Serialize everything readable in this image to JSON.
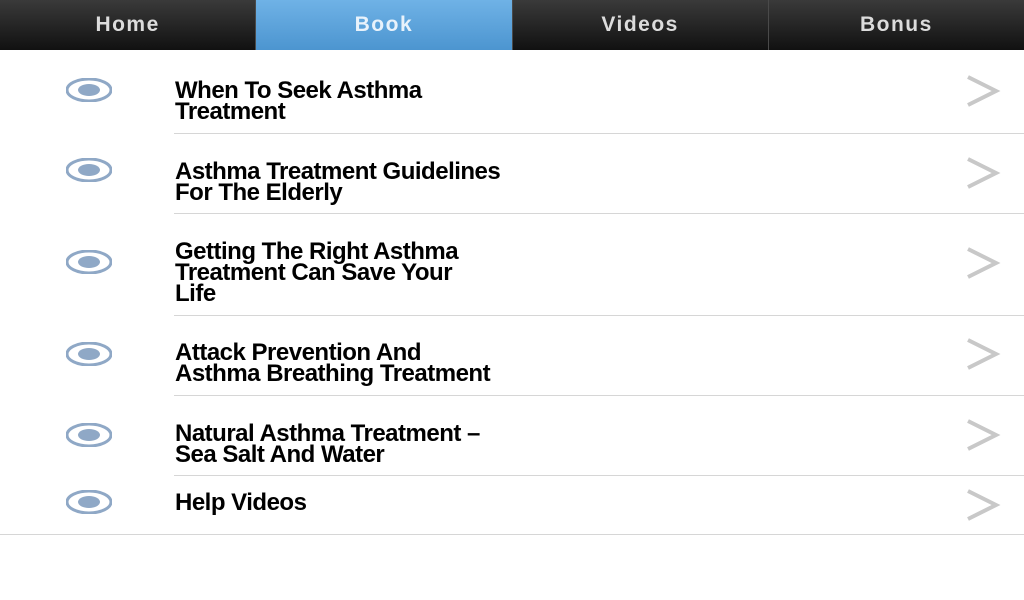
{
  "tabs": [
    {
      "label": "Home",
      "active": false
    },
    {
      "label": "Book",
      "active": true
    },
    {
      "label": "Videos",
      "active": false
    },
    {
      "label": "Bonus",
      "active": false
    }
  ],
  "list_icon": "radio-circle-icon",
  "chevron_icon": "chevron-right-icon",
  "items": [
    {
      "label": "When To Seek Asthma Treatment",
      "line1": "When To Seek Asthma",
      "line2": "Treatment",
      "line3": ""
    },
    {
      "label": "Asthma Treatment Guidelines For The Elderly",
      "line1": "Asthma Treatment Guidelines",
      "line2": "For The Elderly",
      "line3": ""
    },
    {
      "label": "Getting The Right Asthma Treatment Can Save Your Life",
      "line1": "Getting The Right Asthma",
      "line2": "Treatment Can Save Your",
      "line3": "Life"
    },
    {
      "label": "Attack Prevention And Asthma Breathing Treatment",
      "line1": "Attack Prevention And",
      "line2": "Asthma Breathing Treatment",
      "line3": ""
    },
    {
      "label": "Natural Asthma Treatment – Sea Salt And Water",
      "line1": "Natural Asthma Treatment –",
      "line2": "Sea Salt And Water",
      "line3": ""
    },
    {
      "label": "Help Videos",
      "line1": "",
      "line2": "Help Videos",
      "line3": ""
    }
  ],
  "colors": {
    "active_tab": "#5aa3dc",
    "tab_bg": "#1e1e1e",
    "icon": "#8fa8c6",
    "chevron": "#c8c8c8",
    "separator": "#d6d6d6"
  }
}
